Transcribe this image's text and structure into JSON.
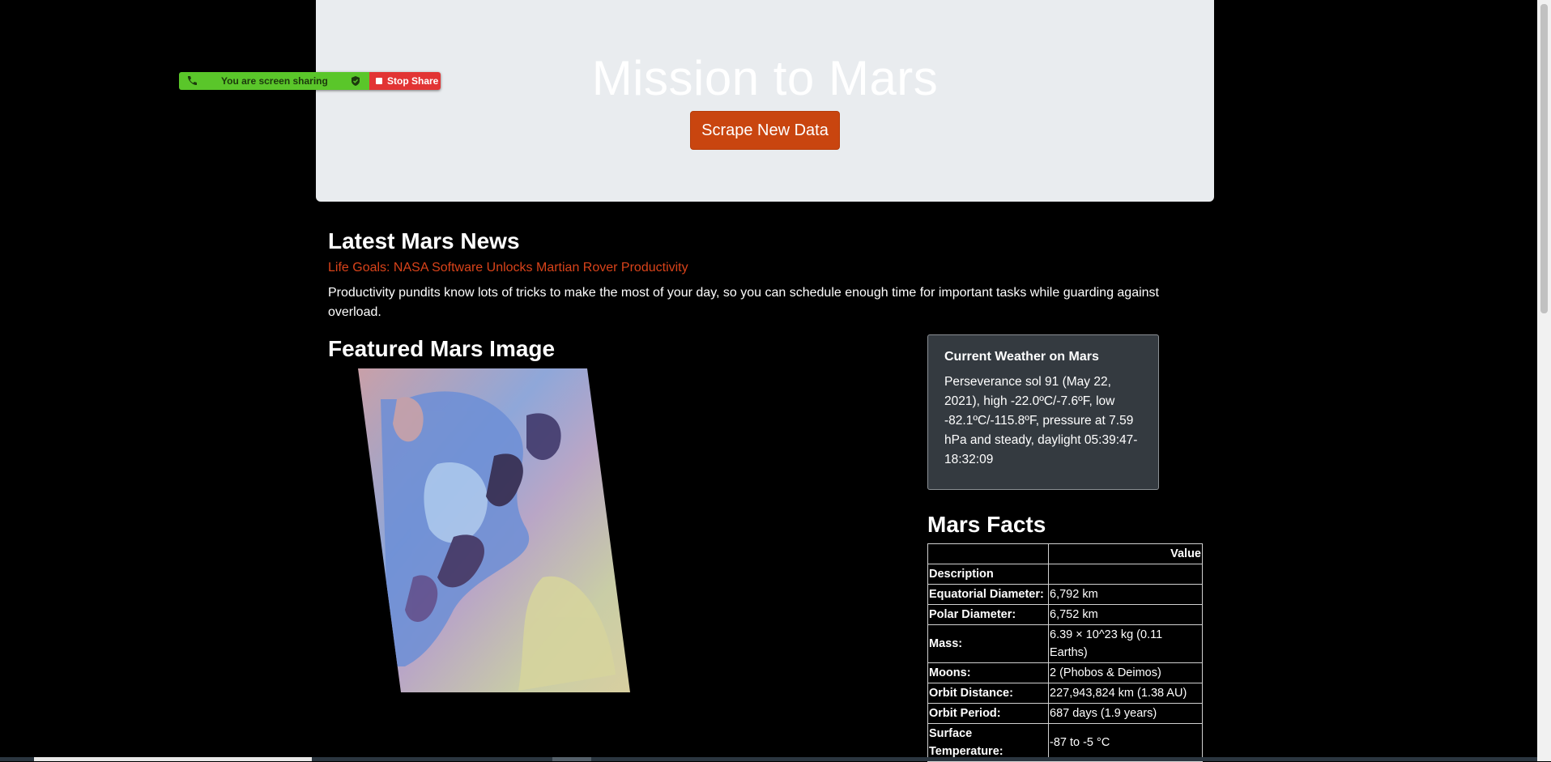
{
  "header": {
    "title": "Mission to Mars",
    "scrape_button": "Scrape New Data"
  },
  "share_bar": {
    "status_text": "You are screen sharing",
    "stop_label": "Stop Share",
    "colors": {
      "green": "#5ac62a",
      "red": "#e23434"
    },
    "icons": [
      "phone-icon",
      "shield-icon",
      "stop-square-icon"
    ]
  },
  "news": {
    "section_title": "Latest Mars News",
    "headline": "Life Goals: NASA Software Unlocks Martian Rover Productivity",
    "teaser": "Productivity pundits know lots of tricks to make the most of your day, so you can schedule enough time for important tasks while guarding against overload."
  },
  "featured": {
    "section_title": "Featured Mars Image"
  },
  "weather": {
    "title": "Current Weather on Mars",
    "text": "Perseverance sol 91 (May 22, 2021), high -22.0ºC/-7.6ºF, low -82.1ºC/-115.8ºF, pressure at 7.59 hPa and steady, daylight 05:39:47-18:32:09"
  },
  "facts": {
    "section_title": "Mars Facts",
    "header": [
      "",
      "Value"
    ],
    "rows": [
      {
        "key": "Description",
        "value": ""
      },
      {
        "key": "Equatorial Diameter:",
        "value": "6,792 km"
      },
      {
        "key": "Polar Diameter:",
        "value": "6,752 km"
      },
      {
        "key": "Mass:",
        "value": "6.39 × 10^23 kg (0.11 Earths)"
      },
      {
        "key": "Moons:",
        "value": "2 (Phobos & Deimos)"
      },
      {
        "key": "Orbit Distance:",
        "value": "227,943,824 km (1.38 AU)"
      },
      {
        "key": "Orbit Period:",
        "value": "687 days (1.9 years)"
      },
      {
        "key": "Surface Temperature:",
        "value": "-87 to -5 °C"
      }
    ]
  },
  "colors": {
    "background": "#000000",
    "jumbotron": "#e9ecef",
    "accent": "#c9450f",
    "news_link": "#d9431a",
    "card": "#343a40"
  }
}
